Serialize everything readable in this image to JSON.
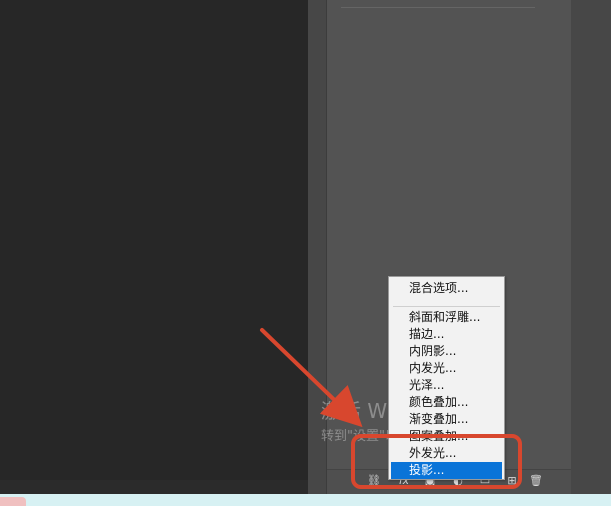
{
  "watermark": {
    "line1": "激活 Windows",
    "line2": "转到\"设置\"以激活 Windows。"
  },
  "menu": {
    "items": [
      "混合选项...",
      "斜面和浮雕...",
      "描边...",
      "内阴影...",
      "内发光...",
      "光泽...",
      "颜色叠加...",
      "渐变叠加...",
      "图案叠加...",
      "外发光...",
      "投影..."
    ],
    "selected": "投影..."
  },
  "panel": {
    "bottom_icons": [
      "link-icon",
      "fx-icon",
      "mask-icon",
      "adjustment-icon",
      "folder-icon",
      "new-layer-icon",
      "trash-icon"
    ]
  },
  "colors": {
    "selection": "#0a74d8",
    "annotation": "#d8472e"
  }
}
